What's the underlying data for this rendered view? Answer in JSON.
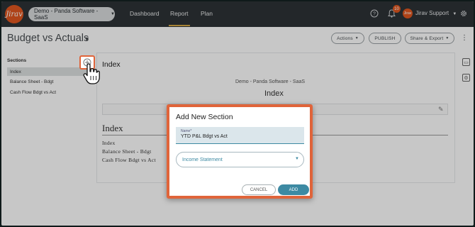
{
  "logo": {
    "text": "Jirav"
  },
  "org_selector": {
    "label": "Demo - Panda Software - SaaS"
  },
  "nav": {
    "tabs": [
      {
        "label": "Dashboard"
      },
      {
        "label": "Report"
      },
      {
        "label": "Plan"
      }
    ],
    "active_tab": "Report"
  },
  "top_icons": {
    "help": "help-icon",
    "notifications": "bell-icon",
    "settings": "gear-icon"
  },
  "notifications": {
    "count": "10"
  },
  "user": {
    "avatar_text": "Jirav",
    "name": "Jirav Support"
  },
  "page": {
    "title": "Budget vs Actuals"
  },
  "actions": {
    "actions_label": "Actions",
    "publish_label": "PUBLISH",
    "share_label": "Share & Export"
  },
  "sidebar": {
    "title": "Sections",
    "items": [
      {
        "label": "Index",
        "selected": true
      },
      {
        "label": "Balance Sheet - Bdgt",
        "selected": false
      },
      {
        "label": "Cash Flow Bdgt vs Act",
        "selected": false
      }
    ]
  },
  "main": {
    "heading": "Index",
    "company": "Demo - Panda Software - SaaS",
    "center_title": "Index",
    "content_title": "Index",
    "content_items": [
      "Index",
      "Balance Sheet - Bdgt",
      "Cash Flow Bdgt vs Act"
    ]
  },
  "modal": {
    "title": "Add New Section",
    "name_label": "Name*",
    "name_value": "YTD P&L Bdgt vs Act",
    "section_type": "Income Statement",
    "cancel_label": "CANCEL",
    "add_label": "ADD"
  },
  "colors": {
    "accent": "#e0643a",
    "primary": "#3d8aa3",
    "topbar": "#2e3337",
    "active_tab_underline": "#d6a845"
  }
}
